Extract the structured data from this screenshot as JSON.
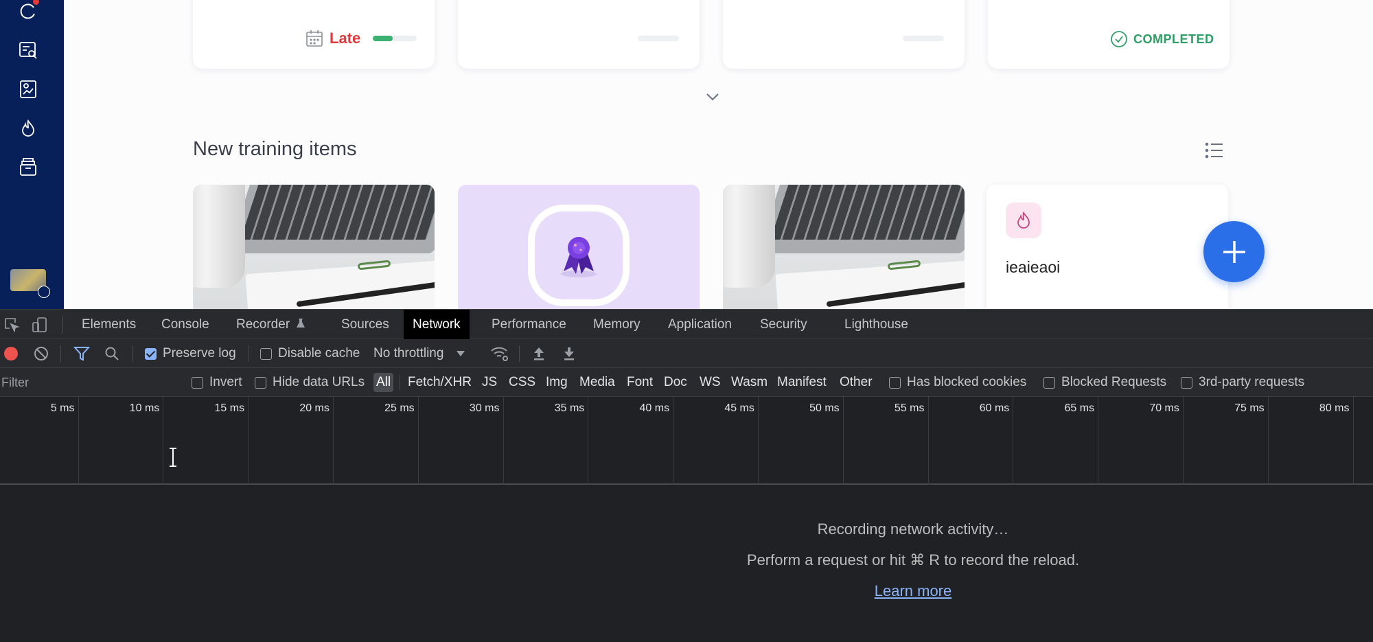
{
  "app": {
    "top_cards": {
      "late_label": "Late",
      "late_progress": 0.45,
      "completed_label": "COMPLETED"
    },
    "section_title": "New training items",
    "text_card_title": "ieaieaoi",
    "colors": {
      "sidebar": "#08205a",
      "late": "#e0383c",
      "completed": "#2e9e66",
      "accent": "#2a6ee8",
      "badge_bg": "#e8dcfb"
    }
  },
  "devtools": {
    "tabs": [
      {
        "label": "Elements"
      },
      {
        "label": "Console"
      },
      {
        "label": "Recorder"
      },
      {
        "label": "Sources"
      },
      {
        "label": "Network"
      },
      {
        "label": "Performance"
      },
      {
        "label": "Memory"
      },
      {
        "label": "Application"
      },
      {
        "label": "Security"
      },
      {
        "label": "Lighthouse"
      }
    ],
    "active_tab": "Network",
    "toolbar": {
      "preserve_log": "Preserve log",
      "preserve_log_checked": true,
      "disable_cache": "Disable cache",
      "disable_cache_checked": false,
      "throttling": "No throttling"
    },
    "filter": {
      "placeholder": "Filter",
      "invert": "Invert",
      "hide_data_urls": "Hide data URLs",
      "types": [
        "All",
        "Fetch/XHR",
        "JS",
        "CSS",
        "Img",
        "Media",
        "Font",
        "Doc",
        "WS",
        "Wasm",
        "Manifest",
        "Other"
      ],
      "active_type": "All",
      "has_blocked_cookies": "Has blocked cookies",
      "blocked_requests": "Blocked Requests",
      "third_party": "3rd-party requests"
    },
    "timeline_ticks": [
      "5 ms",
      "10 ms",
      "15 ms",
      "20 ms",
      "25 ms",
      "30 ms",
      "35 ms",
      "40 ms",
      "45 ms",
      "50 ms",
      "55 ms",
      "60 ms",
      "65 ms",
      "70 ms",
      "75 ms",
      "80 ms"
    ],
    "empty": {
      "title": "Recording network activity…",
      "hint": "Perform a request or hit ⌘ R to record the reload.",
      "learn_more": "Learn more"
    }
  }
}
